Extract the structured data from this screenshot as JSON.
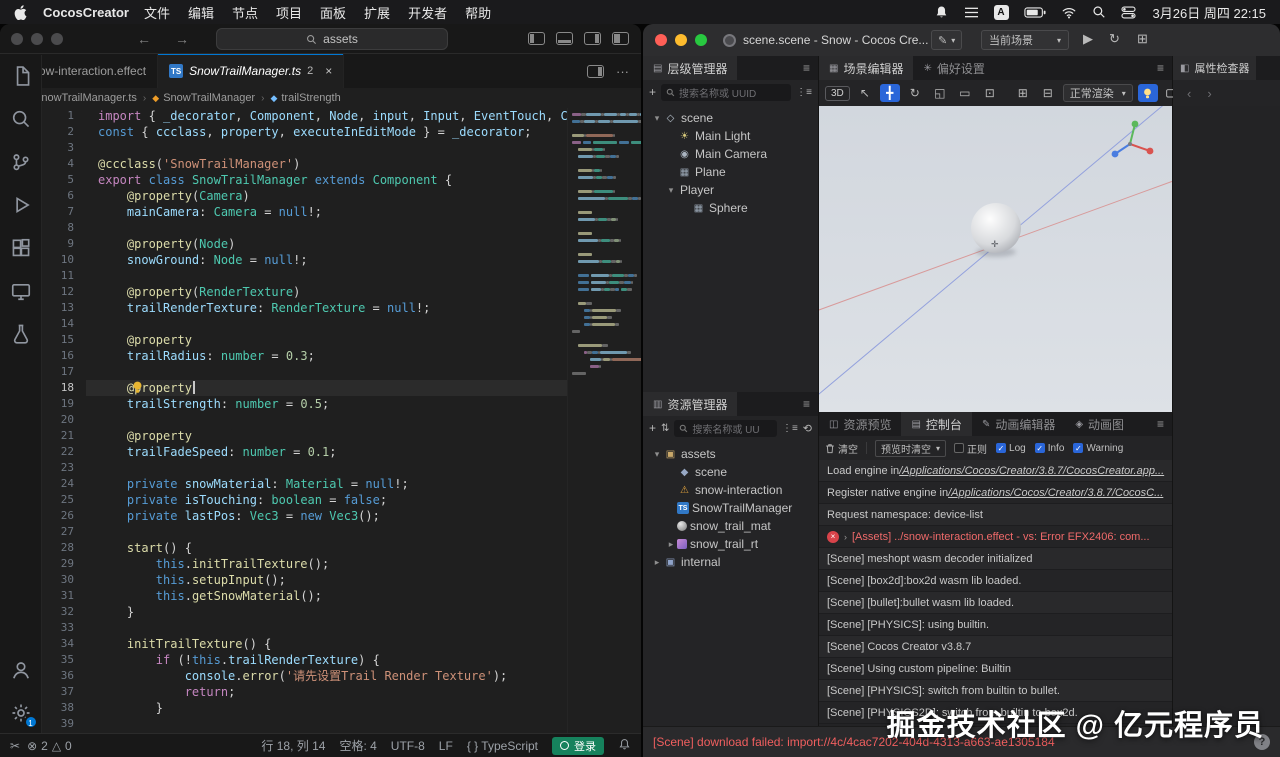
{
  "colors": {
    "accent": "#2a66d9",
    "error": "#e5484d",
    "warning": "#e2a33d",
    "ts_blue": "#3178c6",
    "signin_green": "#16825d"
  },
  "menubar": {
    "app": "CocosCreator",
    "items": [
      "文件",
      "编辑",
      "节点",
      "项目",
      "面板",
      "扩展",
      "开发者",
      "帮助"
    ],
    "clock": "3月26日 周四 22:15"
  },
  "vscode": {
    "command_center": "assets",
    "tabs": [
      {
        "label": "snow-interaction.effect",
        "icon": "effect",
        "active": false
      },
      {
        "label": "SnowTrailManager.ts",
        "icon": "ts",
        "badge": "2",
        "active": true
      }
    ],
    "breadcrumb": [
      {
        "icon": "ts",
        "label": "SnowTrailManager.ts"
      },
      {
        "icon": "class",
        "label": "SnowTrailManager"
      },
      {
        "icon": "prop",
        "label": "trailStrength"
      }
    ],
    "activity": [
      "explorer",
      "search",
      "scm",
      "debug",
      "extensions",
      "remote",
      "testing"
    ],
    "settings_badge": "1",
    "cursor_line": 18,
    "code_lines": [
      [
        [
          "ctrl",
          "import"
        ],
        [
          "pl",
          " { "
        ],
        [
          "var",
          "_decorator"
        ],
        [
          "pl",
          ", "
        ],
        [
          "var",
          "Component"
        ],
        [
          "pl",
          ", "
        ],
        [
          "var",
          "Node"
        ],
        [
          "pl",
          ", "
        ],
        [
          "var",
          "input"
        ],
        [
          "pl",
          ", "
        ],
        [
          "var",
          "Input"
        ],
        [
          "pl",
          ", "
        ],
        [
          "var",
          "EventTouch"
        ],
        [
          "pl",
          ", "
        ],
        [
          "var",
          "Camera"
        ],
        [
          "pl",
          ","
        ]
      ],
      [
        [
          "kw",
          "const"
        ],
        [
          "pl",
          " { "
        ],
        [
          "var",
          "ccclass"
        ],
        [
          "pl",
          ", "
        ],
        [
          "var",
          "property"
        ],
        [
          "pl",
          ", "
        ],
        [
          "var",
          "executeInEditMode"
        ],
        [
          "pl",
          " } = "
        ],
        [
          "var",
          "_decorator"
        ],
        [
          "pl",
          ";"
        ]
      ],
      [],
      [
        [
          "fn",
          "@ccclass"
        ],
        [
          "pl",
          "("
        ],
        [
          "str",
          "'SnowTrailManager'"
        ],
        [
          "pl",
          ")"
        ]
      ],
      [
        [
          "ctrl",
          "export"
        ],
        [
          "pl",
          " "
        ],
        [
          "kw",
          "class"
        ],
        [
          "pl",
          " "
        ],
        [
          "type",
          "SnowTrailManager"
        ],
        [
          "pl",
          " "
        ],
        [
          "kw",
          "extends"
        ],
        [
          "pl",
          " "
        ],
        [
          "type",
          "Component"
        ],
        [
          "pl",
          " {"
        ]
      ],
      [
        [
          "pl",
          "    "
        ],
        [
          "fn",
          "@property"
        ],
        [
          "pl",
          "("
        ],
        [
          "type",
          "Camera"
        ],
        [
          "pl",
          ")"
        ]
      ],
      [
        [
          "pl",
          "    "
        ],
        [
          "var",
          "mainCamera"
        ],
        [
          "pl",
          ": "
        ],
        [
          "type",
          "Camera"
        ],
        [
          "pl",
          " = "
        ],
        [
          "kw",
          "null"
        ],
        [
          "pl",
          "!;"
        ]
      ],
      [],
      [
        [
          "pl",
          "    "
        ],
        [
          "fn",
          "@property"
        ],
        [
          "pl",
          "("
        ],
        [
          "type",
          "Node"
        ],
        [
          "pl",
          ")"
        ]
      ],
      [
        [
          "pl",
          "    "
        ],
        [
          "var",
          "snowGround"
        ],
        [
          "pl",
          ": "
        ],
        [
          "type",
          "Node"
        ],
        [
          "pl",
          " = "
        ],
        [
          "kw",
          "null"
        ],
        [
          "pl",
          "!;"
        ]
      ],
      [],
      [
        [
          "pl",
          "    "
        ],
        [
          "fn",
          "@property"
        ],
        [
          "pl",
          "("
        ],
        [
          "type",
          "RenderTexture"
        ],
        [
          "pl",
          ")"
        ]
      ],
      [
        [
          "pl",
          "    "
        ],
        [
          "var",
          "trailRenderTexture"
        ],
        [
          "pl",
          ": "
        ],
        [
          "type",
          "RenderTexture"
        ],
        [
          "pl",
          " = "
        ],
        [
          "kw",
          "null"
        ],
        [
          "pl",
          "!;"
        ]
      ],
      [],
      [
        [
          "pl",
          "    "
        ],
        [
          "fn",
          "@property"
        ]
      ],
      [
        [
          "pl",
          "    "
        ],
        [
          "var",
          "trailRadius"
        ],
        [
          "pl",
          ": "
        ],
        [
          "type",
          "number"
        ],
        [
          "pl",
          " = "
        ],
        [
          "num",
          "0.3"
        ],
        [
          "pl",
          ";"
        ]
      ],
      [],
      [
        [
          "pl",
          "    "
        ],
        [
          "fn",
          "@property"
        ]
      ],
      [
        [
          "pl",
          "    "
        ],
        [
          "var",
          "trailStrength"
        ],
        [
          "pl",
          ": "
        ],
        [
          "type",
          "number"
        ],
        [
          "pl",
          " = "
        ],
        [
          "num",
          "0.5"
        ],
        [
          "pl",
          ";"
        ]
      ],
      [],
      [
        [
          "pl",
          "    "
        ],
        [
          "fn",
          "@property"
        ]
      ],
      [
        [
          "pl",
          "    "
        ],
        [
          "var",
          "trailFadeSpeed"
        ],
        [
          "pl",
          ": "
        ],
        [
          "type",
          "number"
        ],
        [
          "pl",
          " = "
        ],
        [
          "num",
          "0.1"
        ],
        [
          "pl",
          ";"
        ]
      ],
      [],
      [
        [
          "pl",
          "    "
        ],
        [
          "kw",
          "private"
        ],
        [
          "pl",
          " "
        ],
        [
          "var",
          "snowMaterial"
        ],
        [
          "pl",
          ": "
        ],
        [
          "type",
          "Material"
        ],
        [
          "pl",
          " = "
        ],
        [
          "kw",
          "null"
        ],
        [
          "pl",
          "!;"
        ]
      ],
      [
        [
          "pl",
          "    "
        ],
        [
          "kw",
          "private"
        ],
        [
          "pl",
          " "
        ],
        [
          "var",
          "isTouching"
        ],
        [
          "pl",
          ": "
        ],
        [
          "type",
          "boolean"
        ],
        [
          "pl",
          " = "
        ],
        [
          "kw",
          "false"
        ],
        [
          "pl",
          ";"
        ]
      ],
      [
        [
          "pl",
          "    "
        ],
        [
          "kw",
          "private"
        ],
        [
          "pl",
          " "
        ],
        [
          "var",
          "lastPos"
        ],
        [
          "pl",
          ": "
        ],
        [
          "type",
          "Vec3"
        ],
        [
          "pl",
          " = "
        ],
        [
          "kw",
          "new"
        ],
        [
          "pl",
          " "
        ],
        [
          "type",
          "Vec3"
        ],
        [
          "pl",
          "();"
        ]
      ],
      [],
      [
        [
          "pl",
          "    "
        ],
        [
          "fn",
          "start"
        ],
        [
          "pl",
          "() {"
        ]
      ],
      [
        [
          "pl",
          "        "
        ],
        [
          "kw",
          "this"
        ],
        [
          "pl",
          "."
        ],
        [
          "fn",
          "initTrailTexture"
        ],
        [
          "pl",
          "();"
        ]
      ],
      [
        [
          "pl",
          "        "
        ],
        [
          "kw",
          "this"
        ],
        [
          "pl",
          "."
        ],
        [
          "fn",
          "setupInput"
        ],
        [
          "pl",
          "();"
        ]
      ],
      [
        [
          "pl",
          "        "
        ],
        [
          "kw",
          "this"
        ],
        [
          "pl",
          "."
        ],
        [
          "fn",
          "getSnowMaterial"
        ],
        [
          "pl",
          "();"
        ]
      ],
      [
        [
          "pl",
          "    }"
        ]
      ],
      [],
      [
        [
          "pl",
          "    "
        ],
        [
          "fn",
          "initTrailTexture"
        ],
        [
          "pl",
          "() {"
        ]
      ],
      [
        [
          "pl",
          "        "
        ],
        [
          "ctrl",
          "if"
        ],
        [
          "pl",
          " (!"
        ],
        [
          "kw",
          "this"
        ],
        [
          "pl",
          "."
        ],
        [
          "var",
          "trailRenderTexture"
        ],
        [
          "pl",
          ") {"
        ]
      ],
      [
        [
          "pl",
          "            "
        ],
        [
          "var",
          "console"
        ],
        [
          "pl",
          "."
        ],
        [
          "fn",
          "error"
        ],
        [
          "pl",
          "("
        ],
        [
          "str",
          "'请先设置Trail Render Texture'"
        ],
        [
          "pl",
          ");"
        ]
      ],
      [
        [
          "pl",
          "            "
        ],
        [
          "ctrl",
          "return"
        ],
        [
          "pl",
          ";"
        ]
      ],
      [
        [
          "pl",
          "        }"
        ]
      ],
      []
    ],
    "status": {
      "errors": "2",
      "warnings": "0",
      "line_col": "行 18, 列 14",
      "indent": "空格: 4",
      "encoding": "UTF-8",
      "eol": "LF",
      "lang": "TypeScript",
      "lang_braces": "{ }",
      "signin": "登录"
    }
  },
  "cocos": {
    "title": "scene.scene - Snow - Cocos Cre...",
    "scene_select": "当前场景",
    "hierarchy": {
      "title": "层级管理器",
      "search": "搜索名称或 UUID",
      "tree": [
        {
          "depth": 0,
          "arrow": "down",
          "icon": "scene",
          "label": "scene"
        },
        {
          "depth": 1,
          "arrow": null,
          "icon": "light",
          "label": "Main Light"
        },
        {
          "depth": 1,
          "arrow": null,
          "icon": "camera",
          "label": "Main Camera"
        },
        {
          "depth": 1,
          "arrow": null,
          "icon": "mesh",
          "label": "Plane"
        },
        {
          "depth": 1,
          "arrow": "down",
          "icon": null,
          "label": "Player"
        },
        {
          "depth": 2,
          "arrow": null,
          "icon": "mesh",
          "label": "Sphere"
        }
      ]
    },
    "assets": {
      "title": "资源管理器",
      "search": "搜索名称或 UU",
      "tree": [
        {
          "depth": 0,
          "arrow": "down",
          "icon": "bundle",
          "label": "assets"
        },
        {
          "depth": 1,
          "arrow": null,
          "icon": "scenefile",
          "label": "scene"
        },
        {
          "depth": 1,
          "arrow": null,
          "icon": "warn",
          "label": "snow-interaction"
        },
        {
          "depth": 1,
          "arrow": null,
          "icon": "ts",
          "label": "SnowTrailManager"
        },
        {
          "depth": 1,
          "arrow": null,
          "icon": "mat",
          "label": "snow_trail_mat"
        },
        {
          "depth": 1,
          "arrow": "right",
          "icon": "rt",
          "label": "snow_trail_rt"
        },
        {
          "depth": 0,
          "arrow": "right",
          "icon": "bundle2",
          "label": "internal"
        }
      ]
    },
    "scene_tabs": {
      "tab1": "场景编辑器",
      "tab2": "偏好设置",
      "mode": "3D",
      "render_mode": "正常渲染"
    },
    "console": {
      "tabs": [
        {
          "label": "资源预览",
          "icon": "◫",
          "active": false
        },
        {
          "label": "控制台",
          "icon": "▤",
          "active": true
        },
        {
          "label": "动画编辑器",
          "icon": "✎",
          "active": false
        },
        {
          "label": "动画图",
          "icon": "◈",
          "active": false
        }
      ],
      "clear": "清空",
      "clear_on_preview": "预览时清空",
      "filters": [
        {
          "label": "正则",
          "checked": false
        },
        {
          "label": "Log",
          "checked": true
        },
        {
          "label": "Info",
          "checked": true
        },
        {
          "label": "Warning",
          "checked": true
        }
      ],
      "rows": [
        {
          "kind": "link",
          "pre": "Load engine in ",
          "link": "/Applications/Cocos/Creator/3.8.7/CocosCreator.app..."
        },
        {
          "kind": "link",
          "pre": "Register native engine in ",
          "link": "/Applications/Cocos/Creator/3.8.7/CocosC..."
        },
        {
          "kind": "log",
          "text": "Request namespace: device-list"
        },
        {
          "kind": "error",
          "text": "[Assets] ../snow-interaction.effect - vs: Error EFX2406: com..."
        },
        {
          "kind": "log",
          "text": "[Scene] meshopt wasm decoder initialized"
        },
        {
          "kind": "log",
          "text": "[Scene] [box2d]:box2d wasm lib loaded."
        },
        {
          "kind": "log",
          "text": "[Scene] [bullet]:bullet wasm lib loaded."
        },
        {
          "kind": "log",
          "text": "[Scene] [PHYSICS]: using builtin."
        },
        {
          "kind": "log",
          "text": "[Scene] Cocos Creator v3.8.7"
        },
        {
          "kind": "log",
          "text": "[Scene] Using custom pipeline: Builtin"
        },
        {
          "kind": "log",
          "text": "[Scene] [PHYSICS]: switch from builtin to bullet."
        },
        {
          "kind": "log",
          "text": "[Scene] [PHYSICS2D]: switch from builtin to box2d."
        }
      ],
      "status_line": "[Scene] download failed: import://4c/4cac7202-404d-4313-a663-ae1305184"
    },
    "inspector": {
      "title": "属性检查器"
    }
  },
  "watermark": "掘金技术社区 @ 亿元程序员"
}
